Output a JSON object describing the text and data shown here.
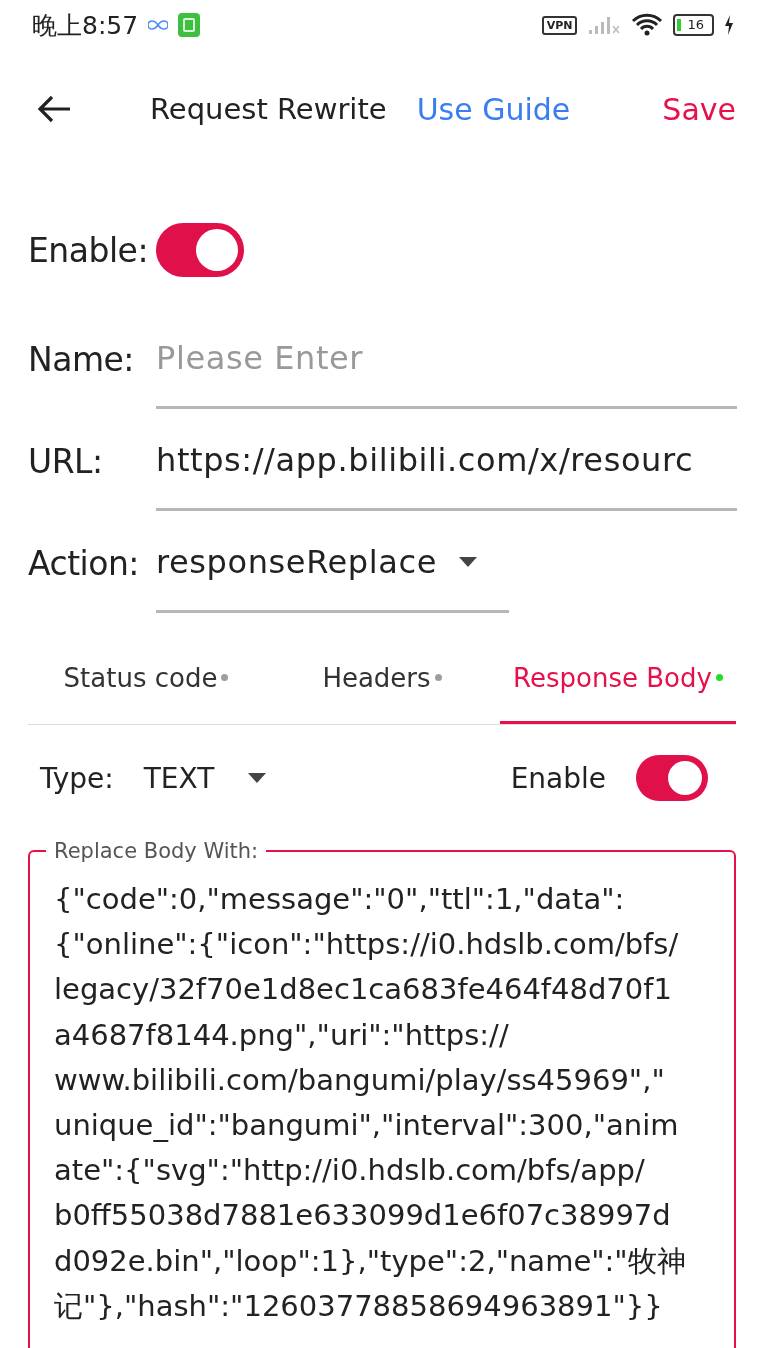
{
  "status_bar": {
    "time": "晚上8:57",
    "vpn": "VPN",
    "battery": "16"
  },
  "header": {
    "title": "Request Rewrite",
    "guide_link": "Use Guide",
    "save": "Save"
  },
  "enable": {
    "label": "Enable:",
    "on": true
  },
  "name": {
    "label": "Name:",
    "placeholder": "Please Enter"
  },
  "url": {
    "label": "URL:",
    "value": "https://app.bilibili.com/x/resourc"
  },
  "action": {
    "label": "Action:",
    "value": "responseReplace"
  },
  "tabs": [
    {
      "label": "Status code",
      "selected": false,
      "color": "#9e9e9e"
    },
    {
      "label": "Headers",
      "selected": false,
      "color": "#9e9e9e"
    },
    {
      "label": "Response Body",
      "selected": true,
      "color": "#22dd22"
    }
  ],
  "type_row": {
    "label": "Type:",
    "value": "TEXT",
    "enable_label": "Enable",
    "enable_on": true
  },
  "body": {
    "legend": "Replace Body With:",
    "lines": [
      "{\"code\":0,\"message\":\"0\",\"ttl\":1,\"data\":",
      "{\"online\":{\"icon\":\"https://i0.hdslb.com/bfs/",
      "legacy/32f70e1d8ec1ca683fe464f48d70f1",
      "a4687f8144.png\",\"uri\":\"https://",
      "www.bilibili.com/bangumi/play/ss45969\",\"",
      "unique_id\":\"bangumi\",\"interval\":300,\"anim",
      "ate\":{\"svg\":\"http://i0.hdslb.com/bfs/app/",
      "b0ff55038d7881e633099d1e6f07c38997d",
      "d092e.bin\",\"loop\":1},\"type\":2,\"name\":\"牧神",
      "记\"},\"hash\":\"12603778858694963891\"}}"
    ]
  }
}
